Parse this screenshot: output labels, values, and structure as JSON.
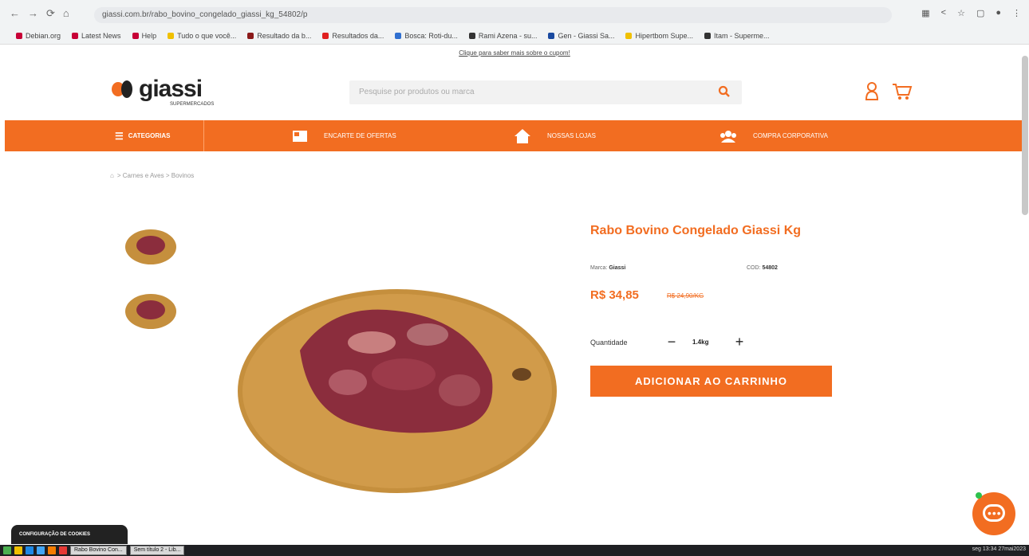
{
  "browser": {
    "url": "giassi.com.br/rabo_bovino_congelado_giassi_kg_54802/p",
    "nav_icons": [
      "←",
      "→",
      "⟳",
      "⌂"
    ],
    "bookmarks": [
      {
        "label": "Debian.org",
        "color": "#c70036"
      },
      {
        "label": "Latest News",
        "color": "#c70036"
      },
      {
        "label": "Help",
        "color": "#c70036"
      },
      {
        "label": "Tudo o que você...",
        "color": "#f0c000"
      },
      {
        "label": "Resultado da b...",
        "color": "#8b1a1a"
      },
      {
        "label": "Resultados da...",
        "color": "#e02020"
      },
      {
        "label": "Bosca: Roti-du...",
        "color": "#3070d0"
      },
      {
        "label": "Rami Azena - su...",
        "color": "#333333"
      },
      {
        "label": "Gen - Giassi Sa...",
        "color": "#1a4aa0"
      },
      {
        "label": "Hipertbom Supe...",
        "color": "#f0c000"
      },
      {
        "label": "Itam - Superme...",
        "color": "#333333"
      }
    ]
  },
  "promo": {
    "text": "Clique para saber mais sobre o cupom!"
  },
  "header": {
    "logo_text": "giassi",
    "logo_sub": "SUPERMERCADOS",
    "search_placeholder": "Pesquise por produtos ou marca"
  },
  "nav": {
    "categories_label": "CATEGORIAS",
    "items": [
      {
        "label": "ENCARTE DE OFERTAS"
      },
      {
        "label": "NOSSAS LOJAS"
      },
      {
        "label": "COMPRA CORPORATIVA"
      }
    ]
  },
  "breadcrumb": {
    "path": "> Carnes e Aves > Bovinos"
  },
  "product": {
    "title": "Rabo Bovino Congelado Giassi Kg",
    "brand_label": "Marca:",
    "brand": "Giassi",
    "sku_label": "COD:",
    "sku": "54802",
    "price": "R$ 34,85",
    "price_old": "R$ 24,90/KG",
    "qty_label": "Quantidade",
    "qty_value": "1.4kg",
    "add_button": "ADICIONAR AO CARRINHO"
  },
  "cookie": {
    "label": "CONFIGURAÇÃO DE COOKIES"
  },
  "taskbar": {
    "windows": [
      "Rabo Bovino Con...",
      "Sem título 2 - Lib..."
    ],
    "clock": "seg 13:34 27mai2023"
  },
  "colors": {
    "brand": "#f26d21",
    "meat": "#8b2d3d",
    "board": "#c58f3d"
  }
}
